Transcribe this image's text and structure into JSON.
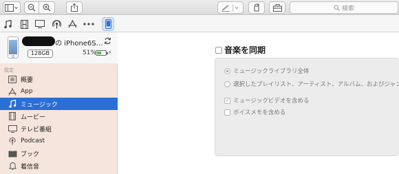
{
  "toolbar": {
    "search_placeholder": "検索"
  },
  "device": {
    "name_suffix": "の iPhone6S…",
    "capacity": "128GB",
    "battery_percent": "51%",
    "battery_level": 0.51,
    "charging_symbol": "⚡"
  },
  "sidebar": {
    "section_label": "設定",
    "items": [
      {
        "label": "概要",
        "icon": "summary-list-icon"
      },
      {
        "label": "App",
        "icon": "app-store-icon"
      },
      {
        "label": "ミュージック",
        "icon": "music-note-icon"
      },
      {
        "label": "ムービー",
        "icon": "film-icon"
      },
      {
        "label": "テレビ番組",
        "icon": "tv-icon"
      },
      {
        "label": "Podcast",
        "icon": "podcast-icon"
      },
      {
        "label": "ブック",
        "icon": "book-icon"
      },
      {
        "label": "着信音",
        "icon": "bell-icon"
      }
    ],
    "selected_index": 2
  },
  "main": {
    "sync_label": "音楽を同期",
    "options": {
      "entire_library": "ミュージックライブラリ全体",
      "selected": "選択したプレイリスト、アーティスト、アルバム、およびジャンル",
      "include_videos": "ミュージックビデオを含める",
      "include_voice_memos": "ボイスメモを含める"
    }
  },
  "colors": {
    "sidebar_bg": "#f6e5dc",
    "selection": "#2b6ed5",
    "panel_bg": "#ececec"
  }
}
